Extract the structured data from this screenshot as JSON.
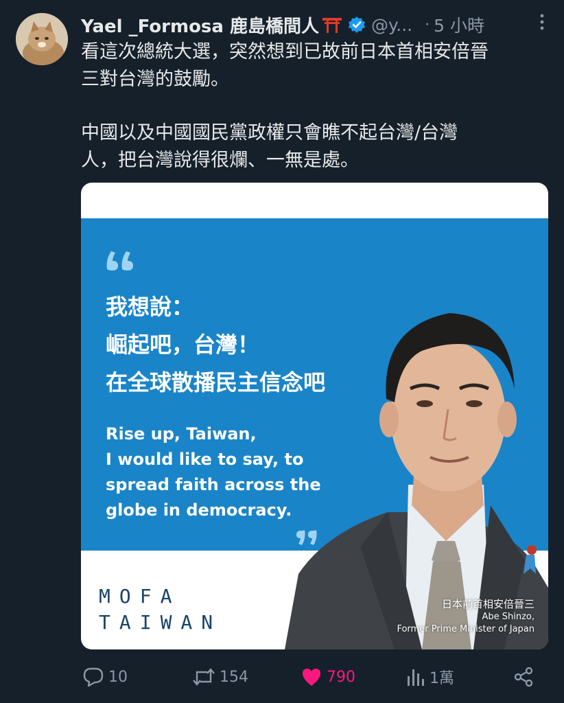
{
  "author": {
    "display_name": "Yael _Formosa 鹿島橋間人",
    "handle": "@y...",
    "time": "5 小時",
    "separator": "·"
  },
  "tweet": {
    "paragraphs": [
      [
        "看這次總統大選，突然想到已故前日本首相安倍晉",
        "三對台灣的鼓勵。"
      ],
      [
        "中國以及中國國民黨政權只會瞧不起台灣/台灣",
        "人，把台灣說得很爛、一無是處。"
      ]
    ]
  },
  "media": {
    "zh_lines": [
      "我想說：",
      "崛起吧，台灣！",
      "在全球散播民主信念吧"
    ],
    "en_lines": [
      "Rise up, Taiwan,",
      "I would like to say, to",
      "spread faith across the",
      "globe in democracy."
    ],
    "logo_line1": "MOFA",
    "logo_line2": "TAIWAN",
    "caption_zh": "日本前首相安倍晉三",
    "caption_name": "Abe Shinzo,",
    "caption_role": "Former Prime Minister of Japan",
    "colors": {
      "band": "#1a84c8",
      "quote_marks": "#9fd3f2",
      "logo": "#18446b"
    }
  },
  "actions": {
    "replies": "10",
    "retweets": "154",
    "likes": "790",
    "views": "1萬"
  },
  "icons": [
    "more-icon",
    "verified-badge-icon",
    "torii-emoji-icon",
    "reply-icon",
    "retweet-icon",
    "like-icon",
    "views-icon",
    "share-icon"
  ],
  "colors": {
    "background": "#16202b",
    "text": "#e7e9ea",
    "muted": "#8b98a5",
    "verified": "#1d9bf0",
    "like": "#f91880"
  }
}
